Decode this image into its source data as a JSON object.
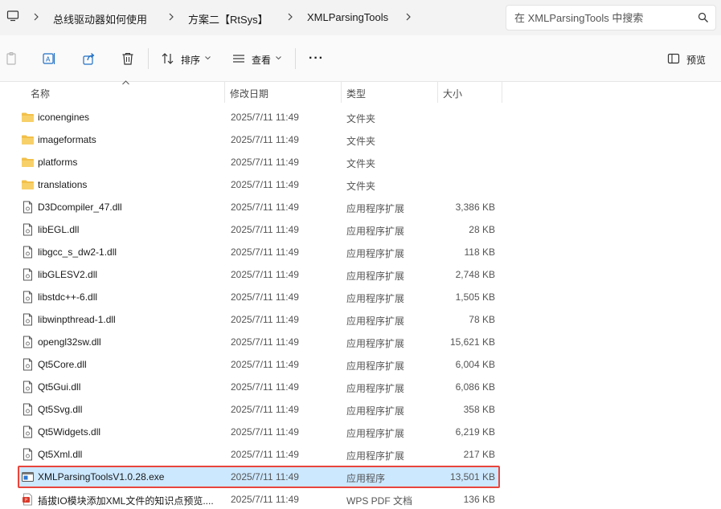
{
  "breadcrumb": [
    "总线驱动器如何使用",
    "方案二【RtSys】",
    "XMLParsingTools"
  ],
  "search": {
    "placeholder": "在 XMLParsingTools 中搜索"
  },
  "toolbar": {
    "sort_label": "排序",
    "view_label": "查看",
    "more_label": "···",
    "preview_label": "预览"
  },
  "columns": {
    "name": "名称",
    "date": "修改日期",
    "type": "类型",
    "size": "大小"
  },
  "files": [
    {
      "name": "iconengines",
      "date": "2025/7/11 11:49",
      "type": "文件夹",
      "size": "",
      "icon": "folder-icon"
    },
    {
      "name": "imageformats",
      "date": "2025/7/11 11:49",
      "type": "文件夹",
      "size": "",
      "icon": "folder-icon"
    },
    {
      "name": "platforms",
      "date": "2025/7/11 11:49",
      "type": "文件夹",
      "size": "",
      "icon": "folder-icon"
    },
    {
      "name": "translations",
      "date": "2025/7/11 11:49",
      "type": "文件夹",
      "size": "",
      "icon": "folder-icon"
    },
    {
      "name": "D3Dcompiler_47.dll",
      "date": "2025/7/11 11:49",
      "type": "应用程序扩展",
      "size": "3,386 KB",
      "icon": "dll-file-icon"
    },
    {
      "name": "libEGL.dll",
      "date": "2025/7/11 11:49",
      "type": "应用程序扩展",
      "size": "28 KB",
      "icon": "dll-file-icon"
    },
    {
      "name": "libgcc_s_dw2-1.dll",
      "date": "2025/7/11 11:49",
      "type": "应用程序扩展",
      "size": "118 KB",
      "icon": "dll-file-icon"
    },
    {
      "name": "libGLESV2.dll",
      "date": "2025/7/11 11:49",
      "type": "应用程序扩展",
      "size": "2,748 KB",
      "icon": "dll-file-icon"
    },
    {
      "name": "libstdc++-6.dll",
      "date": "2025/7/11 11:49",
      "type": "应用程序扩展",
      "size": "1,505 KB",
      "icon": "dll-file-icon"
    },
    {
      "name": "libwinpthread-1.dll",
      "date": "2025/7/11 11:49",
      "type": "应用程序扩展",
      "size": "78 KB",
      "icon": "dll-file-icon"
    },
    {
      "name": "opengl32sw.dll",
      "date": "2025/7/11 11:49",
      "type": "应用程序扩展",
      "size": "15,621 KB",
      "icon": "dll-file-icon"
    },
    {
      "name": "Qt5Core.dll",
      "date": "2025/7/11 11:49",
      "type": "应用程序扩展",
      "size": "6,004 KB",
      "icon": "dll-file-icon"
    },
    {
      "name": "Qt5Gui.dll",
      "date": "2025/7/11 11:49",
      "type": "应用程序扩展",
      "size": "6,086 KB",
      "icon": "dll-file-icon"
    },
    {
      "name": "Qt5Svg.dll",
      "date": "2025/7/11 11:49",
      "type": "应用程序扩展",
      "size": "358 KB",
      "icon": "dll-file-icon"
    },
    {
      "name": "Qt5Widgets.dll",
      "date": "2025/7/11 11:49",
      "type": "应用程序扩展",
      "size": "6,219 KB",
      "icon": "dll-file-icon"
    },
    {
      "name": "Qt5Xml.dll",
      "date": "2025/7/11 11:49",
      "type": "应用程序扩展",
      "size": "217 KB",
      "icon": "dll-file-icon"
    },
    {
      "name": "XMLParsingToolsV1.0.28.exe",
      "date": "2025/7/11 11:49",
      "type": "应用程序",
      "size": "13,501 KB",
      "icon": "exe-file-icon",
      "selected": true
    },
    {
      "name": "插拔IO模块添加XML文件的知识点预览....",
      "date": "2025/7/11 11:49",
      "type": "WPS PDF 文档",
      "size": "136 KB",
      "icon": "pdf-file-icon"
    }
  ],
  "colors": {
    "folder": "#f2c04a",
    "selection": "#cce8ff",
    "highlight_border": "#e8453c",
    "pdf": "#d93a2b"
  }
}
